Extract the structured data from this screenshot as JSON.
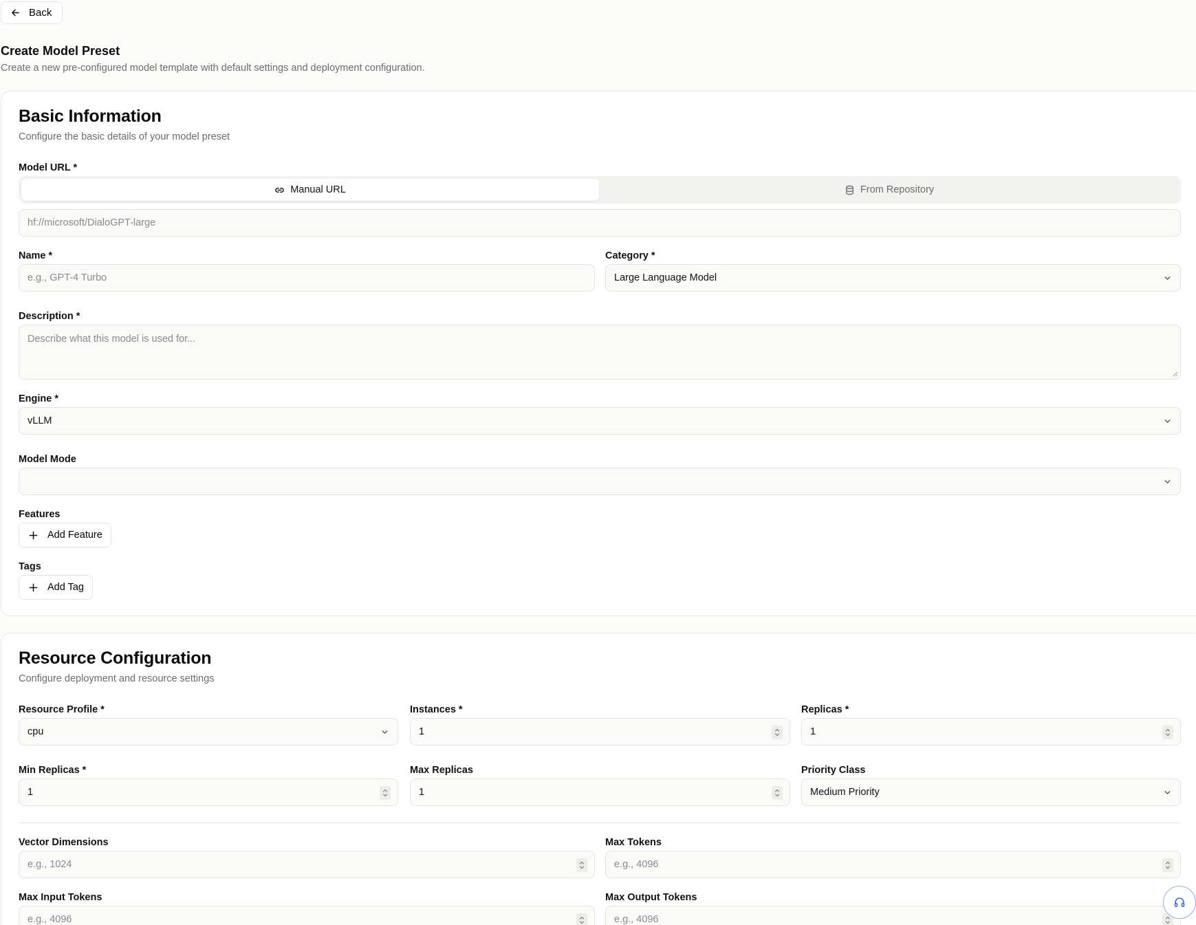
{
  "back_label": "Back",
  "page": {
    "title": "Create Model Preset",
    "subtitle": "Create a new pre-configured model template with default settings and deployment configuration."
  },
  "basic": {
    "title": "Basic Information",
    "subtitle": "Configure the basic details of your model preset",
    "model_url_label": "Model URL *",
    "tab_manual": "Manual URL",
    "tab_repo": "From Repository",
    "model_url_placeholder": "hf://microsoft/DialoGPT-large",
    "name_label": "Name *",
    "name_placeholder": "e.g., GPT-4 Turbo",
    "category_label": "Category *",
    "category_value": "Large Language Model",
    "description_label": "Description *",
    "description_placeholder": "Describe what this model is used for...",
    "engine_label": "Engine *",
    "engine_value": "vLLM",
    "mode_label": "Model Mode",
    "mode_value": "",
    "features_label": "Features",
    "add_feature": "Add Feature",
    "tags_label": "Tags",
    "add_tag": "Add Tag"
  },
  "resource": {
    "title": "Resource Configuration",
    "subtitle": "Configure deployment and resource settings",
    "profile_label": "Resource Profile *",
    "profile_value": "cpu",
    "instances_label": "Instances *",
    "instances_value": "1",
    "replicas_label": "Replicas *",
    "replicas_value": "1",
    "min_replicas_label": "Min Replicas *",
    "min_replicas_value": "1",
    "max_replicas_label": "Max Replicas",
    "max_replicas_value": "1",
    "priority_label": "Priority Class",
    "priority_value": "Medium Priority",
    "vector_label": "Vector Dimensions",
    "vector_placeholder": "e.g., 1024",
    "max_tokens_label": "Max Tokens",
    "max_tokens_placeholder": "e.g., 4096",
    "max_input_label": "Max Input Tokens",
    "max_input_placeholder": "e.g., 4096",
    "max_output_label": "Max Output Tokens",
    "max_output_placeholder": "e.g., 4096"
  },
  "icons": {
    "back": "arrow-left-icon",
    "link": "link-icon",
    "database": "database-icon",
    "chevron": "chevron-down-icon",
    "spinner": "chevron-up-down-icon",
    "plus": "plus-icon",
    "help": "headphones-icon"
  }
}
